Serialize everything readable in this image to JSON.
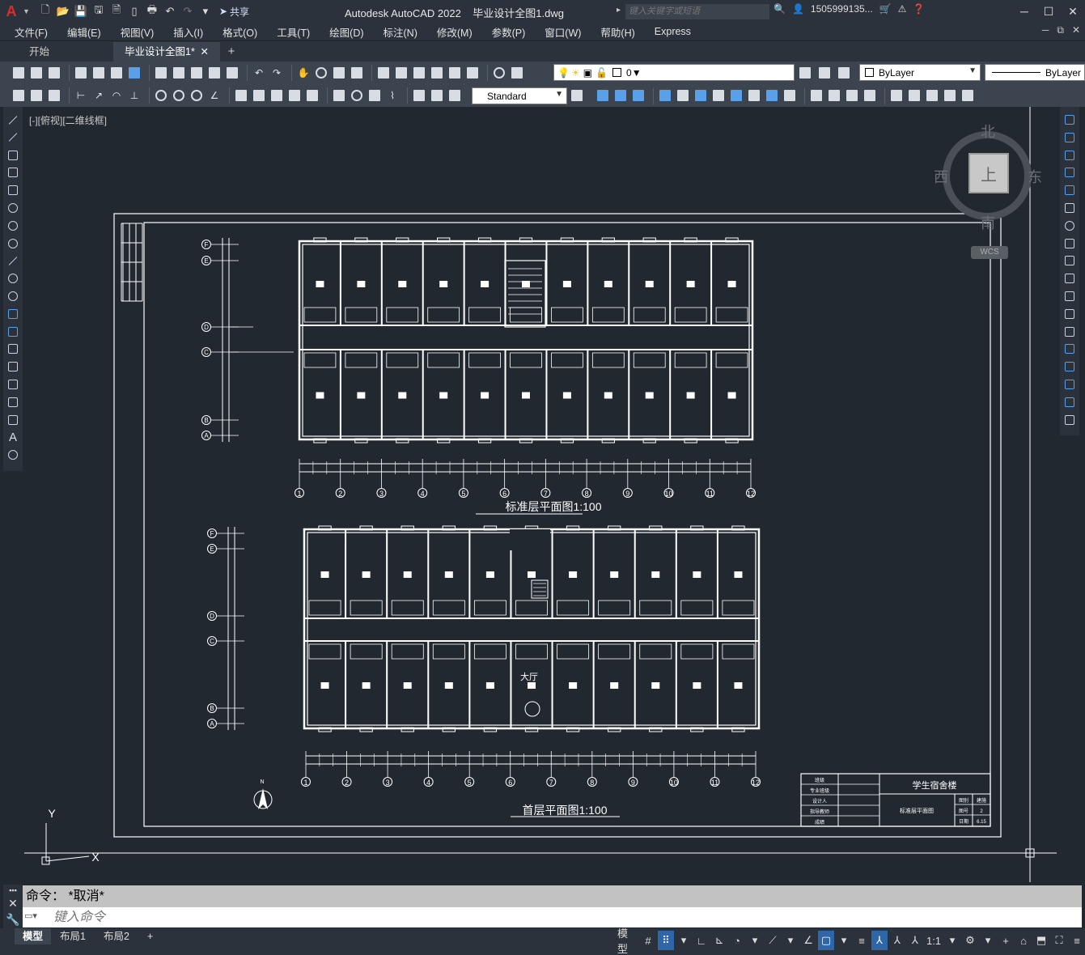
{
  "app": {
    "title": "Autodesk AutoCAD 2022",
    "filename": "毕业设计全图1.dwg",
    "share_label": "共享",
    "search_placeholder": "键入关键字或短语",
    "user": "1505999135...",
    "logo": "A"
  },
  "menu": [
    "文件(F)",
    "编辑(E)",
    "视图(V)",
    "插入(I)",
    "格式(O)",
    "工具(T)",
    "绘图(D)",
    "标注(N)",
    "修改(M)",
    "参数(P)",
    "窗口(W)",
    "帮助(H)",
    "Express"
  ],
  "doc_tabs": {
    "start": "开始",
    "active": "毕业设计全图1*",
    "close": "✕",
    "plus": "+"
  },
  "layer": {
    "name": "0",
    "color_combo": "ByLayer",
    "linetype_combo": "ByLayer"
  },
  "text_style": "Standard",
  "viewport": {
    "label": "[-][俯视][二维线框]",
    "viewcube": {
      "north": "北",
      "south": "南",
      "east": "东",
      "west": "西",
      "face": "上",
      "wcs": "WCS"
    }
  },
  "drawing": {
    "standard_floor_title": "标准层平面图1:100",
    "ground_floor_title": "首层平面图1:100",
    "column_axes": [
      "1",
      "2",
      "3",
      "4",
      "5",
      "6",
      "7",
      "8",
      "9",
      "10",
      "11",
      "12"
    ],
    "row_axes": [
      "F",
      "E",
      "D",
      "C",
      "B",
      "A"
    ],
    "lobby_label": "大厅",
    "north_label": "N",
    "title_block": {
      "project": "学生宿舍楼",
      "drawing_name": "标准层平面图",
      "rows": [
        "班级",
        "专业班级",
        "设计人",
        "指导教师",
        "成绩"
      ],
      "right": [
        "图别",
        "图号",
        "日期"
      ],
      "right_vals": [
        "建施",
        "2",
        "6.15"
      ]
    }
  },
  "command": {
    "history": "命令： *取消*",
    "placeholder": "键入命令"
  },
  "layout_tabs": [
    "模型",
    "布局1",
    "布局2"
  ],
  "layout_plus": "+",
  "status": {
    "model": "模型",
    "scale": "1:1"
  },
  "colors": {
    "accent": "#2f66a8",
    "background": "#212830",
    "panel": "#2b323b",
    "toolbar": "#3b444f"
  }
}
